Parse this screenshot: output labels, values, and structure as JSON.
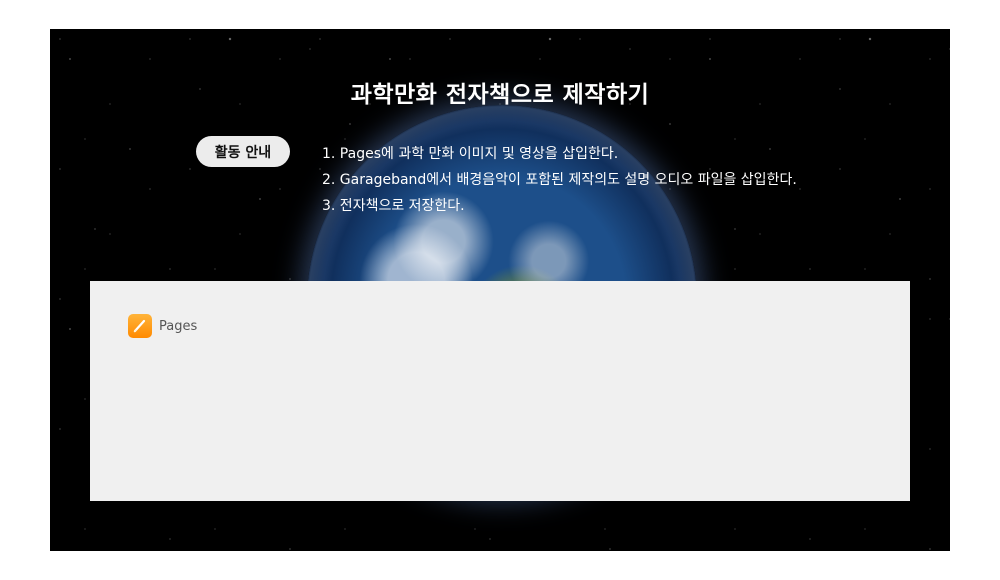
{
  "page": {
    "title": "과학만화 전자책으로 제작하기"
  },
  "guide": {
    "badge": "활동 안내",
    "steps": [
      "1. Pages에 과학 만화 이미지 및 영상을 삽입한다.",
      "2. Garageband에서 배경음악이 포함된 제작의도 설명 오디오 파일을 삽입한다.",
      "3. 전자책으로 저장한다."
    ]
  },
  "panel": {
    "apps": [
      {
        "label": "Pages",
        "icon": "pages-pen-icon",
        "color": "#ff9500"
      }
    ]
  },
  "colors": {
    "background": "#000000",
    "panel": "#f0f0f0",
    "badge": "#ececec"
  }
}
